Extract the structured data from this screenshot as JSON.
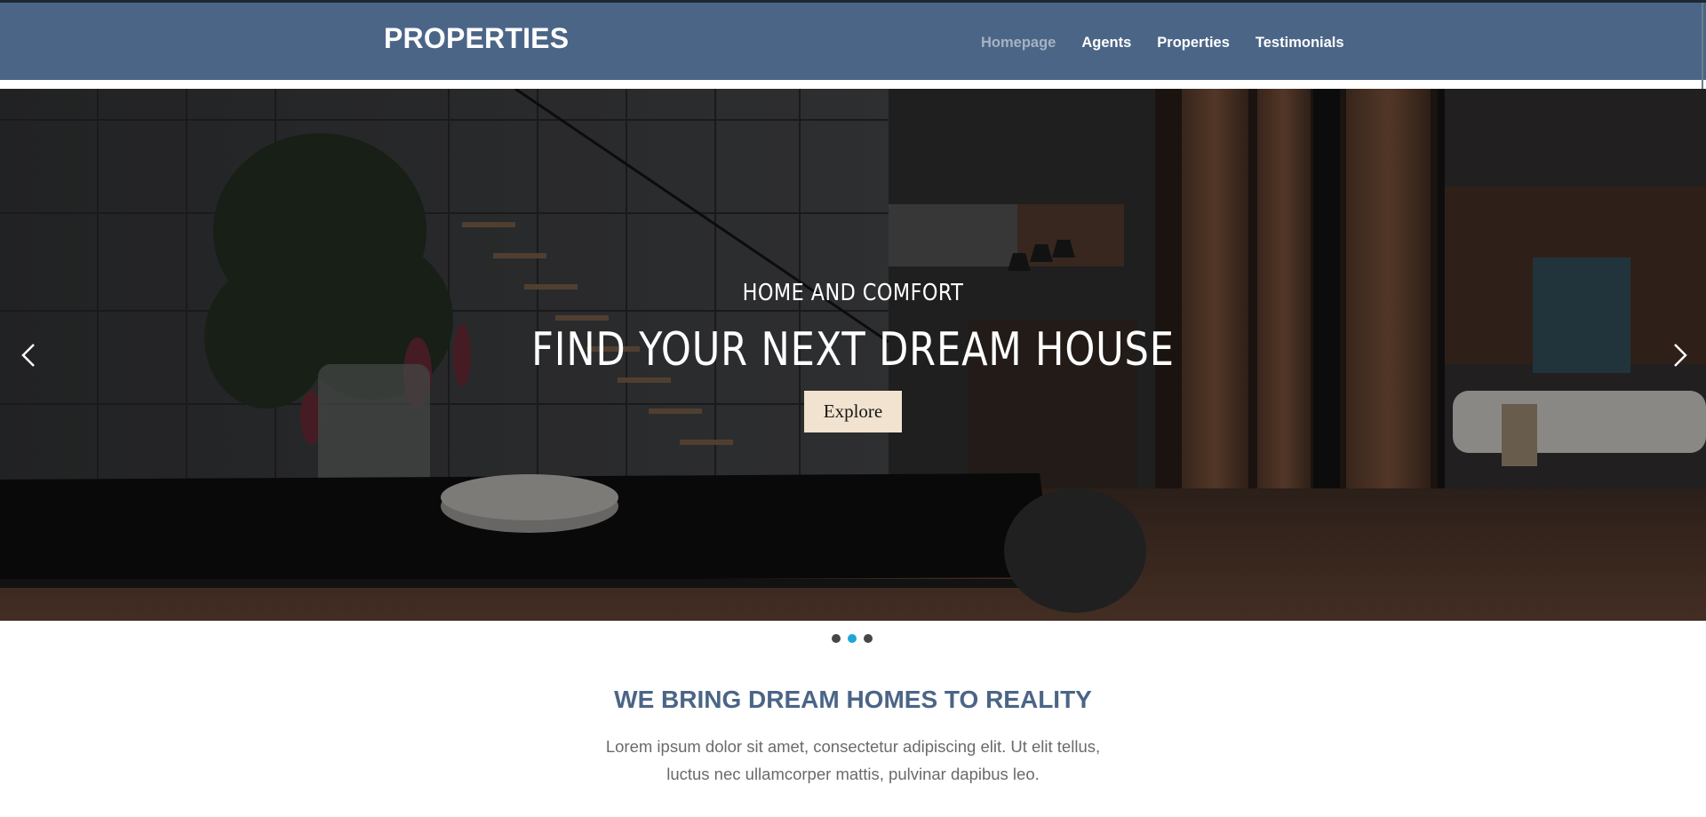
{
  "header": {
    "brand": "PROPERTIES",
    "nav": [
      {
        "label": "Homepage",
        "active": true
      },
      {
        "label": "Agents",
        "active": false
      },
      {
        "label": "Properties",
        "active": false
      },
      {
        "label": "Testimonials",
        "active": false
      }
    ]
  },
  "hero": {
    "kicker": "HOME AND COMFORT",
    "title": "FIND YOUR NEXT DREAM HOUSE",
    "cta_label": "Explore",
    "prev_icon": "chevron-left-icon",
    "next_icon": "chevron-right-icon"
  },
  "carousel": {
    "slide_count": 3,
    "active_slide": 2
  },
  "intro": {
    "title": "WE BRING DREAM HOMES TO REALITY",
    "text": "Lorem ipsum dolor sit amet, consectetur adipiscing elit. Ut elit tellus, luctus nec ullamcorper mattis, pulvinar dapibus leo."
  },
  "colors": {
    "header_bg": "#4b6587",
    "nav_active": "#a6b2c2",
    "accent_dot": "#1ea7d6",
    "cta_bg": "#f1e3cf",
    "intro_title": "#4b6587"
  }
}
